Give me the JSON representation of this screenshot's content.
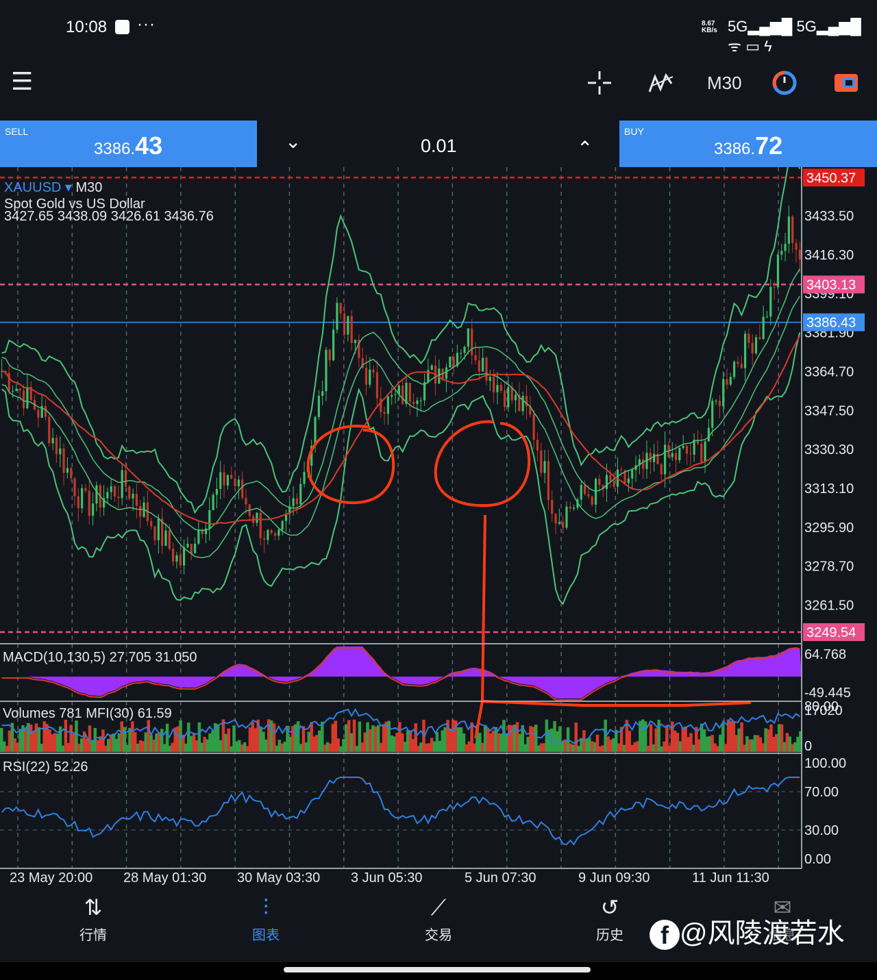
{
  "status": {
    "time": "10:08",
    "more": "···",
    "net_speed_value": "8.67",
    "net_speed_unit": "KB/s",
    "icons": "5G▂▄▆█ 5G▂▄▆█ ᯤ ▭ ϟ"
  },
  "toolbar": {
    "menu_icon": "☰",
    "crosshair_icon": "┼",
    "indicators_icon": "〰",
    "timeframe": "M30",
    "clock_icon": "◔",
    "trade_icon": "⇄"
  },
  "trade": {
    "sell_label": "SELL",
    "sell_price_prefix": "3386.",
    "sell_price_big": "43",
    "buy_label": "BUY",
    "buy_price_prefix": "3386.",
    "buy_price_big": "72",
    "lot": "0.01",
    "down_icon": "⌄",
    "up_icon": "⌃"
  },
  "chart": {
    "symbol": "XAUUSD",
    "timeframe": "M30",
    "description": "Spot Gold vs US Dollar",
    "ohlc": "3427.65 3438.09 3426.61 3436.76",
    "price_axis": [
      "3433.50",
      "3416.30",
      "3399.10",
      "3381.90",
      "3364.70",
      "3347.50",
      "3330.30",
      "3313.10",
      "3295.90",
      "3278.70",
      "3261.50"
    ],
    "price_axis_values": [
      3433.5,
      3416.3,
      3399.1,
      3381.9,
      3364.7,
      3347.5,
      3330.3,
      3313.1,
      3295.9,
      3278.7,
      3261.5
    ],
    "price_range": [
      3245,
      3455
    ],
    "level_lines": [
      {
        "label": "3450.37",
        "value": 3450.37,
        "color": "#e0201c"
      },
      {
        "label": "3403.13",
        "value": 3403.13,
        "color": "#e8508c"
      },
      {
        "label": "3386.43",
        "value": 3386.43,
        "color": "#3d8ef0"
      },
      {
        "label": "3249.54",
        "value": 3249.54,
        "color": "#e8508c"
      }
    ],
    "time_axis": [
      "23 May 20:00",
      "28 May 01:30",
      "30 May 03:30",
      "3 Jun 05:30",
      "5 Jun 07:30",
      "9 Jun 09:30",
      "11 Jun 11:30"
    ],
    "macd": {
      "label": "MACD(10,130,5) 27.705 31.050",
      "axis_top": "64.768",
      "axis_bottom": "-49.445"
    },
    "volumes": {
      "label": "Volumes 781 MFI(30) 61.59",
      "axis_top": "80.00",
      "axis_top2": "17020",
      "axis_bottom": "0"
    },
    "rsi": {
      "label": "RSI(22) 52.26",
      "axis": [
        "100.00",
        "70.00",
        "30.00",
        "0.00"
      ],
      "axis_values": [
        100,
        70,
        30,
        0
      ]
    }
  },
  "nav": {
    "items": [
      {
        "label": "行情",
        "icon": "⇅"
      },
      {
        "label": "图表",
        "icon": "⫶"
      },
      {
        "label": "交易",
        "icon": "⟋"
      },
      {
        "label": "历史",
        "icon": "↺"
      },
      {
        "label": "信息",
        "icon": "✉"
      }
    ]
  },
  "watermark": "@风陵渡若水",
  "watermark_icon": "f",
  "colors": {
    "accent": "#3d8ef0",
    "bull": "#3fbf6b",
    "bear": "#c0392b",
    "bands": "#4cc27a",
    "ma": "#d63a2c",
    "macd": "#9b30ff",
    "annotation": "#ff3a14"
  }
}
